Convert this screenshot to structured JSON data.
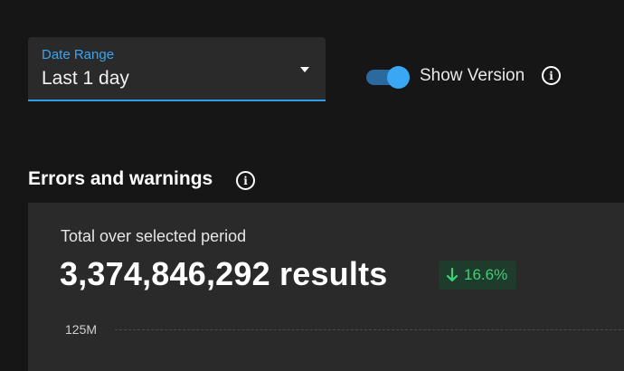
{
  "filters": {
    "date_range": {
      "label": "Date Range",
      "value": "Last 1 day"
    },
    "show_version": {
      "label": "Show Version",
      "enabled": true
    }
  },
  "section": {
    "title": "Errors and warnings"
  },
  "summary": {
    "subtitle": "Total over selected period",
    "total": "3,374,846,292 results",
    "change": {
      "direction": "down",
      "value": "16.6%"
    }
  },
  "chart": {
    "y_tick": "125M"
  },
  "colors": {
    "accent": "#39a7f4",
    "positive": "#3fcf78",
    "background": "#161616",
    "card": "#2a2a2a"
  },
  "icons": {
    "info": "info-icon",
    "caret": "chevron-down-icon",
    "trend": "arrow-down-icon"
  }
}
